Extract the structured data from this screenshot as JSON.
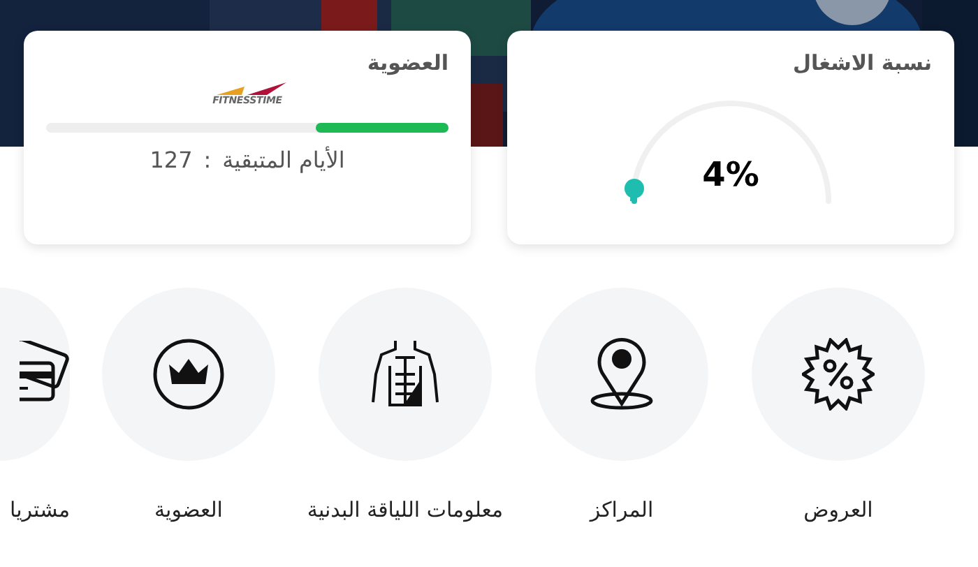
{
  "cards": [
    {
      "kind": "occupancy",
      "title": "نسبة الاشغال",
      "value": "4%",
      "level": 0.04
    },
    {
      "kind": "membership",
      "title": "العضوية",
      "logo_text": "FITNESSTIME",
      "level": 0.33,
      "remaining_label": "الأيام المتبقية",
      "separator": ":",
      "remaining_value": "127"
    }
  ],
  "shortcuts": [
    {
      "kind": "percent",
      "label": "العروض"
    },
    {
      "kind": "pin",
      "label": "المراكز"
    },
    {
      "kind": "torso",
      "label": "معلومات اللياقة البدنية"
    },
    {
      "kind": "crown",
      "label": "العضوية"
    },
    {
      "kind": "cards",
      "label": "مشتريا"
    }
  ]
}
